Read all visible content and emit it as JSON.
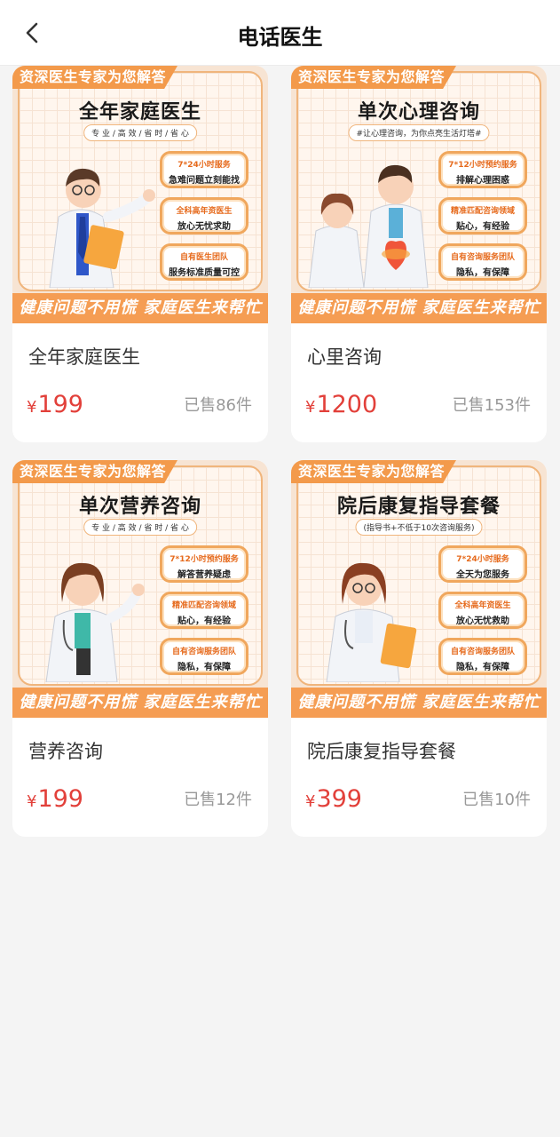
{
  "header": {
    "title": "电话医生",
    "back_icon": "chevron-left-icon"
  },
  "colors": {
    "accent_orange": "#f59d53",
    "price_red": "#e2403a",
    "muted": "#999999"
  },
  "products": [
    {
      "banner": {
        "ribbon": "资深医生专家为您解答",
        "title": "全年家庭医生",
        "subtitle": "专 业 / 高 效 / 省 时 / 省 心",
        "features": [
          {
            "top": "7*24小时服务",
            "bottom": "急难问题立刻能找"
          },
          {
            "top": "全科高年资医生",
            "bottom": "放心无忧求助"
          },
          {
            "top": "自有医生团队",
            "bottom": "服务标准质量可控"
          }
        ],
        "bottom_text": "健康问题不用慌 家庭医生来帮忙"
      },
      "name": "全年家庭医生",
      "currency": "¥",
      "price": "199",
      "sold": "已售86件"
    },
    {
      "banner": {
        "ribbon": "资深医生专家为您解答",
        "title": "单次心理咨询",
        "subtitle": "#让心理咨询，为你点亮生活灯塔#",
        "features": [
          {
            "top": "7*12小时预约服务",
            "bottom": "排解心理困惑"
          },
          {
            "top": "精准匹配咨询领域",
            "bottom": "贴心，有经验"
          },
          {
            "top": "自有咨询服务团队",
            "bottom": "隐私，有保障"
          }
        ],
        "bottom_text": "健康问题不用慌 家庭医生来帮忙"
      },
      "name": "心里咨询",
      "currency": "¥",
      "price": "1200",
      "sold": "已售153件"
    },
    {
      "banner": {
        "ribbon": "资深医生专家为您解答",
        "title": "单次营养咨询",
        "subtitle": "专 业 / 高 效 / 省 时 / 省 心",
        "features": [
          {
            "top": "7*12小时预约服务",
            "bottom": "解答营养疑虑"
          },
          {
            "top": "精准匹配咨询领域",
            "bottom": "贴心，有经验"
          },
          {
            "top": "自有咨询服务团队",
            "bottom": "隐私，有保障"
          }
        ],
        "bottom_text": "健康问题不用慌 家庭医生来帮忙"
      },
      "name": "营养咨询",
      "currency": "¥",
      "price": "199",
      "sold": "已售12件"
    },
    {
      "banner": {
        "ribbon": "资深医生专家为您解答",
        "title": "院后康复指导套餐",
        "subtitle": "(指导书+不低于10次咨询服务)",
        "features": [
          {
            "top": "7*24小时服务",
            "bottom": "全天为您服务"
          },
          {
            "top": "全科高年资医生",
            "bottom": "放心无忧救助"
          },
          {
            "top": "自有咨询服务团队",
            "bottom": "隐私，有保障"
          }
        ],
        "bottom_text": "健康问题不用慌 家庭医生来帮忙"
      },
      "name": "院后康复指导套餐",
      "currency": "¥",
      "price": "399",
      "sold": "已售10件"
    }
  ]
}
